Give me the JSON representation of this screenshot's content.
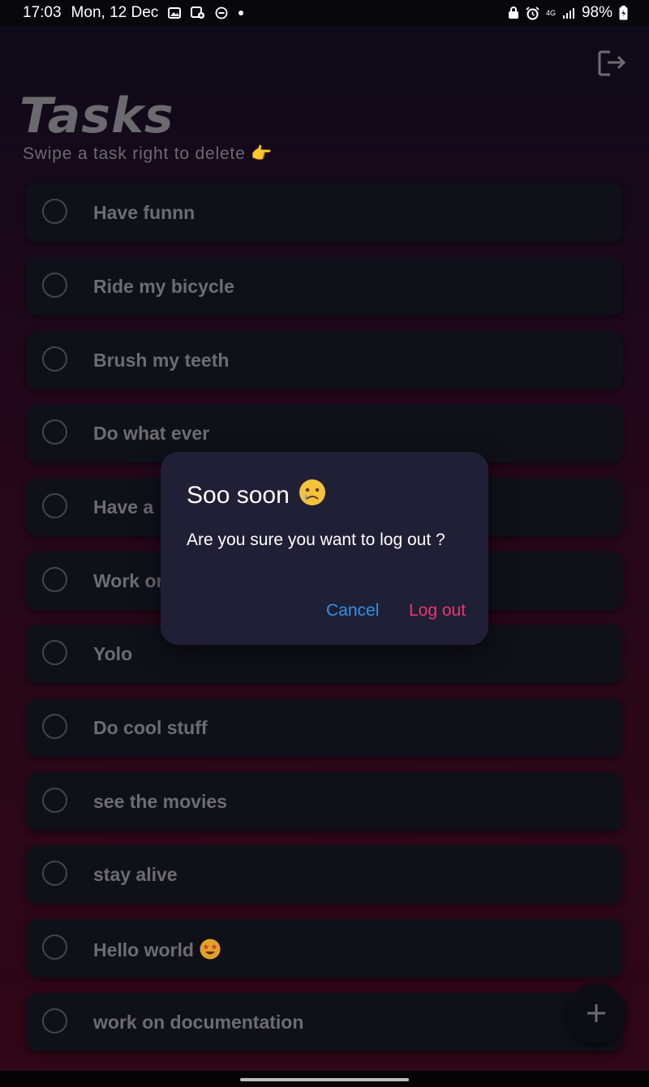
{
  "status_bar": {
    "time": "17:03",
    "date": "Mon, 12 Dec",
    "network": "4G",
    "battery": "98%"
  },
  "header": {
    "title": "Tasks",
    "subtitle": "Swipe a task right to delete 👉"
  },
  "tasks": [
    {
      "label": "Have funnn"
    },
    {
      "label": "Ride my bicycle"
    },
    {
      "label": "Brush my teeth"
    },
    {
      "label": "Do what ever"
    },
    {
      "label": "Have a"
    },
    {
      "label": "Work on"
    },
    {
      "label": "Yolo"
    },
    {
      "label": "Do cool stuff"
    },
    {
      "label": "see the movies"
    },
    {
      "label": "stay alive"
    },
    {
      "label": "Hello world"
    },
    {
      "label": "work on documentation"
    }
  ],
  "dialog": {
    "title": "Soo soon",
    "message": "Are you sure you want to log out ?",
    "cancel_label": "Cancel",
    "confirm_label": "Log out"
  },
  "colors": {
    "accent_cancel": "#2f92e8",
    "accent_logout": "#e83a6f",
    "dialog_bg": "#1f1f35"
  },
  "icons": {
    "logout": "logout-icon",
    "add": "plus-icon"
  }
}
